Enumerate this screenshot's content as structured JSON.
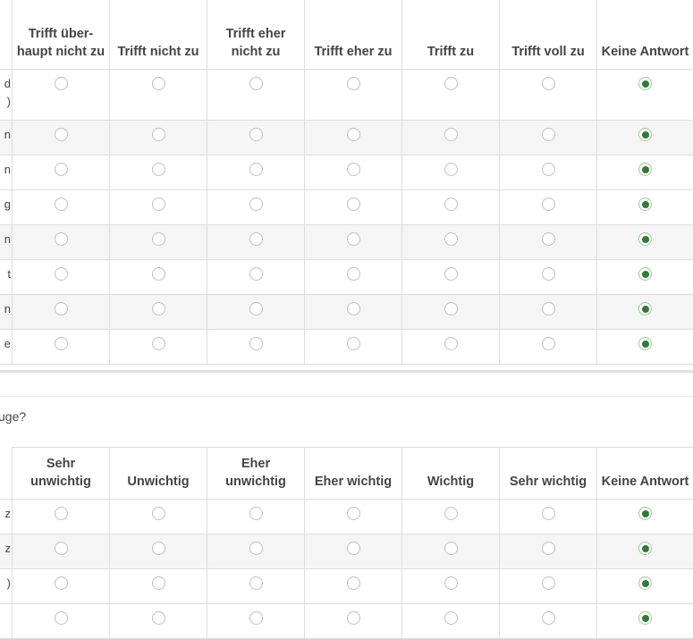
{
  "grid1": {
    "columns": [
      "Trifft über-haupt nicht zu",
      "Trifft nicht zu",
      "Trifft eher nicht zu",
      "Trifft eher zu",
      "Trifft zu",
      "Trifft voll zu",
      "Keine Antwort"
    ],
    "rows": [
      {
        "label_lines": [
          "d",
          ")"
        ],
        "selected": 6
      },
      {
        "label_lines": [
          "n"
        ],
        "selected": 6
      },
      {
        "label_lines": [
          "n"
        ],
        "selected": 6
      },
      {
        "label_lines": [
          "g"
        ],
        "selected": 6
      },
      {
        "label_lines": [
          "n"
        ],
        "selected": 6
      },
      {
        "label_lines": [
          "t"
        ],
        "selected": 6
      },
      {
        "label_lines": [
          "n"
        ],
        "selected": 6
      },
      {
        "label_lines": [
          "e"
        ],
        "selected": 6
      }
    ]
  },
  "question2": {
    "text": "uge?"
  },
  "grid2": {
    "columns": [
      "Sehr unwichtig",
      "Unwichtig",
      "Eher unwichtig",
      "Eher wichtig",
      "Wichtig",
      "Sehr wichtig",
      "Keine Antwort"
    ],
    "rows": [
      {
        "label_lines": [
          "z"
        ],
        "selected": 6
      },
      {
        "label_lines": [
          "z"
        ],
        "selected": 6
      },
      {
        "label_lines": [
          ")"
        ],
        "selected": 6
      },
      {
        "label_lines": [
          ""
        ],
        "selected": 6
      }
    ]
  },
  "colors": {
    "checked": "#2e7d32",
    "row_alt": "#f5f5f5",
    "border": "#dddddd"
  }
}
